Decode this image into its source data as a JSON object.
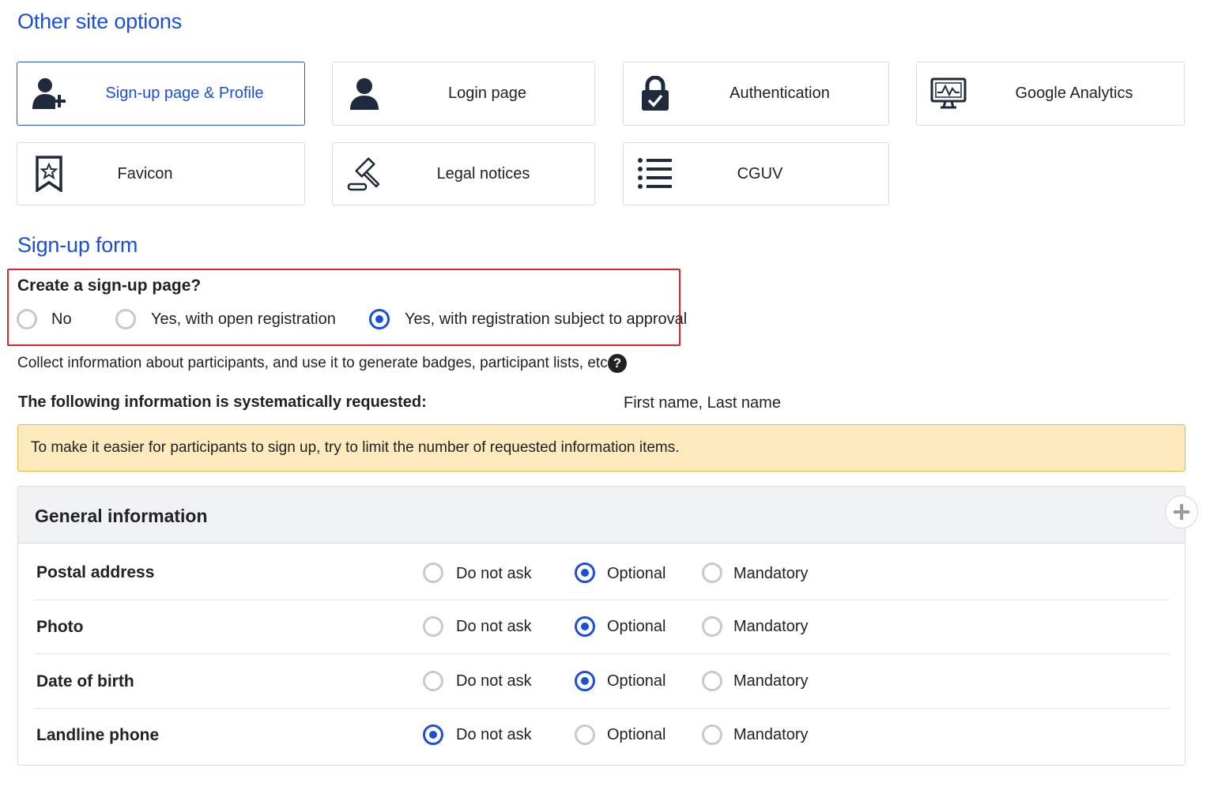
{
  "sections": {
    "other_options_title": "Other site options",
    "signup_form_title": "Sign-up form"
  },
  "cards": [
    {
      "label": "Sign-up page & Profile",
      "icon": "user-plus-icon",
      "active": true
    },
    {
      "label": "Login page",
      "icon": "user-icon",
      "active": false
    },
    {
      "label": "Authentication",
      "icon": "lock-check-icon",
      "active": false
    },
    {
      "label": "Google Analytics",
      "icon": "monitor-chart-icon",
      "active": false
    },
    {
      "label": "Favicon",
      "icon": "bookmark-star-icon",
      "active": false
    },
    {
      "label": "Legal notices",
      "icon": "gavel-icon",
      "active": false
    },
    {
      "label": "CGUV",
      "icon": "list-icon",
      "active": false
    }
  ],
  "signup_question": {
    "title": "Create a sign-up page?",
    "options": [
      "No",
      "Yes, with open registration",
      "Yes, with registration subject to approval"
    ],
    "selected": "Yes, with registration subject to approval"
  },
  "collect_info": "Collect information about participants, and use it to generate badges, participant lists, etc.",
  "systematic": {
    "label": "The following information is systematically requested:",
    "value": "First name, Last name"
  },
  "notice": "To make it easier for participants to sign up, try to limit the number of requested information items.",
  "general_info": {
    "title": "General information",
    "choices": [
      "Do not ask",
      "Optional",
      "Mandatory"
    ],
    "rows": [
      {
        "label": "Postal address",
        "selected": "Optional"
      },
      {
        "label": "Photo",
        "selected": "Optional"
      },
      {
        "label": "Date of birth",
        "selected": "Optional"
      },
      {
        "label": "Landline phone",
        "selected": "Do not ask"
      }
    ]
  },
  "colors": {
    "accent": "#1a4fd8",
    "highlight_border": "#e3242b",
    "notice_bg": "#fdebbd",
    "notice_border": "#e5b84a"
  }
}
